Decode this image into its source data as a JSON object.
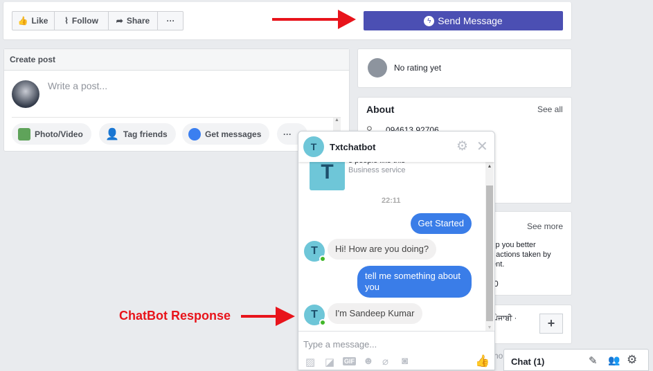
{
  "page_actions": {
    "like": "Like",
    "follow": "Follow",
    "share": "Share",
    "more": "···",
    "send_message": "Send Message"
  },
  "create_post": {
    "title": "Create post",
    "placeholder": "Write a post...",
    "actions": [
      "Photo/Video",
      "Tag friends",
      "Get messages",
      "···"
    ]
  },
  "rating": {
    "text": "No rating yet"
  },
  "about": {
    "title": "About",
    "see_all": "See all",
    "phone": "094613 92706"
  },
  "card3": {
    "see_more": "See more",
    "text_lines": [
      "elp you better",
      "e actions taken by",
      "tent."
    ],
    "number": "0"
  },
  "card4": {
    "lang": "ਪੰਜਾਬੀ ·",
    "add": "+"
  },
  "chat_bar": {
    "label": "Chat (1)",
    "partial": "ho"
  },
  "chat": {
    "name": "Txtchatbot",
    "avatar_letter": "T",
    "page_likes": "3 people like this",
    "category": "Business service",
    "timestamp": "22:11",
    "messages": [
      {
        "from": "user",
        "text": "Get Started"
      },
      {
        "from": "bot",
        "text": "Hi! How are you doing?"
      },
      {
        "from": "user",
        "text": "tell me something about you"
      },
      {
        "from": "bot",
        "text": "I'm Sandeep Kumar"
      }
    ],
    "input_placeholder": "Type a message..."
  },
  "annotation": {
    "label": "ChatBot Response",
    "color": "#e8141b"
  },
  "colors": {
    "send_button": "#4b4fb3",
    "bubble_out": "#3a7de8",
    "background": "#e9ebee"
  }
}
